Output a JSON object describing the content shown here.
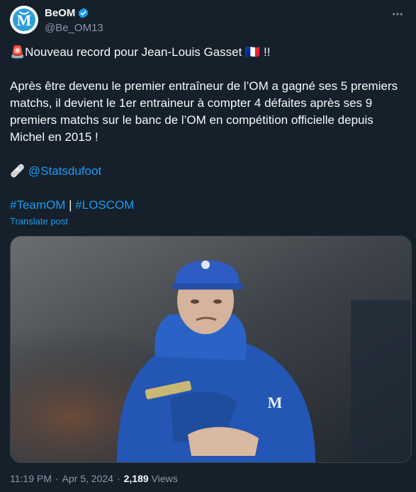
{
  "account": {
    "display_name": "BeOM",
    "handle": "@Be_OM13"
  },
  "post": {
    "line1_emoji": "🚨",
    "line1_text": "Nouveau record pour Jean-Louis Gasset ",
    "line1_flag": "🇫🇷",
    "line1_end": " !!",
    "body": "Après être devenu le premier entraîneur de l’OM a gagné ses 5 premiers matchs, il devient le 1er entraineur à compter 4 défaites après ses 9 premiers matchs sur le banc de l’OM en compétition officielle depuis Michel en 2015 !",
    "credit_emoji": "🩹",
    "credit_link": "@Statsdufoot",
    "hashtag1": "#TeamOM",
    "hashtag_sep": " | ",
    "hashtag2": "#LOSCOM",
    "translate_label": "Translate post"
  },
  "footer": {
    "time": "11:19 PM",
    "dot1": "·",
    "date": "Apr 5, 2024",
    "dot2": "·",
    "views_count": "2,189",
    "views_label": "Views"
  },
  "colors": {
    "background": "#15202b",
    "text": "#f7f9f9",
    "muted": "#8b98a5",
    "link": "#1d9bf0",
    "om_blue": "#2f6fd0"
  },
  "icons": {
    "verified": "verified-badge-icon",
    "more": "more-dots-icon"
  }
}
